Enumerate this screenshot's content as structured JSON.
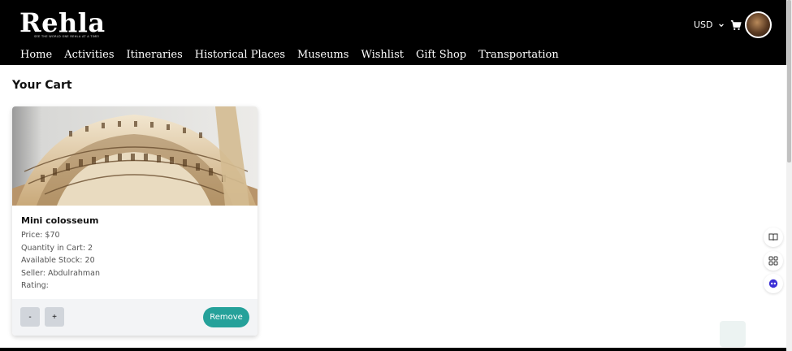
{
  "header": {
    "logo": "Rehla",
    "tagline": "SEE THE WORLD ONE REHLA AT A TIME!",
    "nav": [
      "Home",
      "Activities",
      "Itineraries",
      "Historical Places",
      "Museums",
      "Wishlist",
      "Gift Shop",
      "Transportation"
    ],
    "currency": "USD"
  },
  "page": {
    "title": "Your Cart"
  },
  "cart": {
    "items": [
      {
        "name": "Mini colosseum",
        "price": "Price: $70",
        "quantity": "Quantity in Cart: 2",
        "stock": "Available Stock: 20",
        "seller": "Seller: Abdulrahman",
        "rating": "Rating:",
        "decrease_label": "-",
        "increase_label": "+",
        "remove_label": "Remove"
      }
    ]
  },
  "colors": {
    "accent": "#25a19a",
    "header_bg": "#000000"
  },
  "icons": [
    "chevron-down-icon",
    "cart-icon",
    "book-icon",
    "grid-icon",
    "bot-icon"
  ]
}
